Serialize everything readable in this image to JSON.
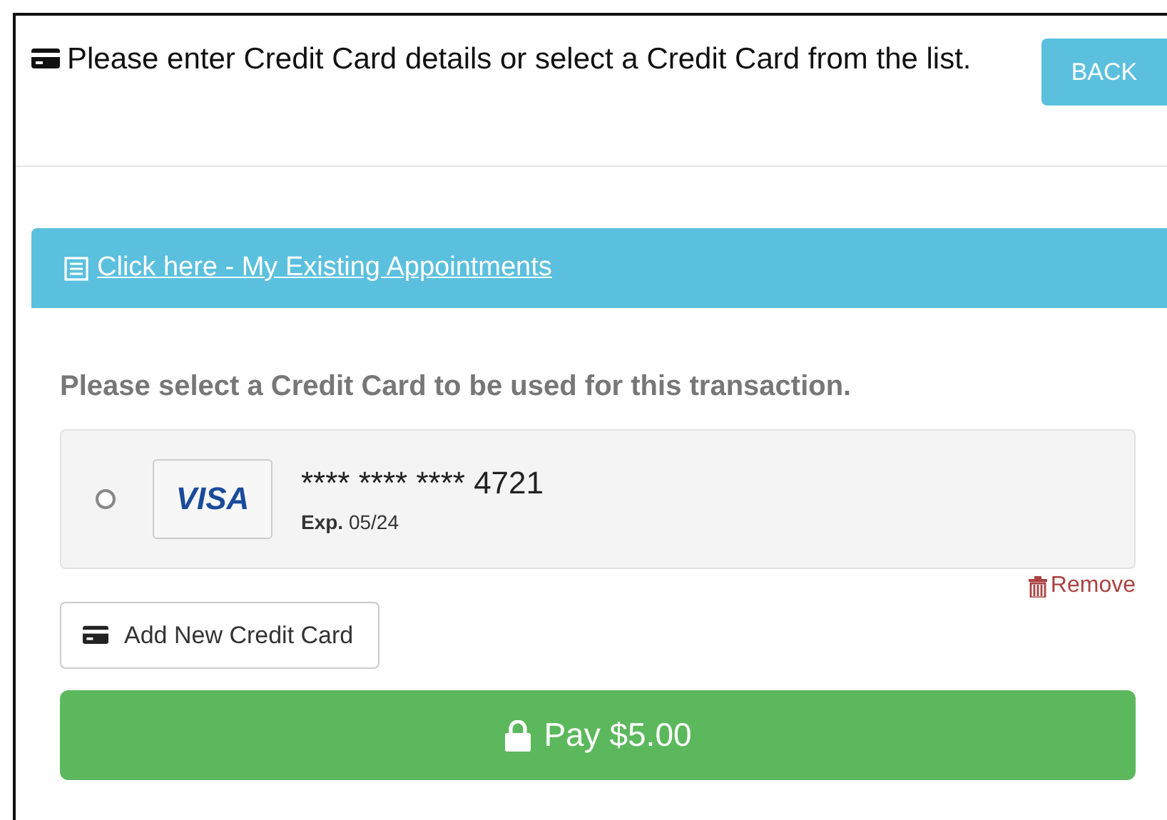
{
  "header": {
    "message": "Please enter Credit Card details or select a Credit Card from the list.",
    "back_button": "BACK"
  },
  "appointments_link": "Click here - My Existing Appointments",
  "select_heading": "Please select a Credit Card to be used for this transaction.",
  "cards": [
    {
      "brand": "VISA",
      "number": "**** **** **** 4721",
      "exp_label": "Exp.",
      "exp": "05/24",
      "selected": false,
      "remove": "Remove"
    }
  ],
  "add_card_button": "Add New Credit Card",
  "pay_button": "Pay $5.00"
}
